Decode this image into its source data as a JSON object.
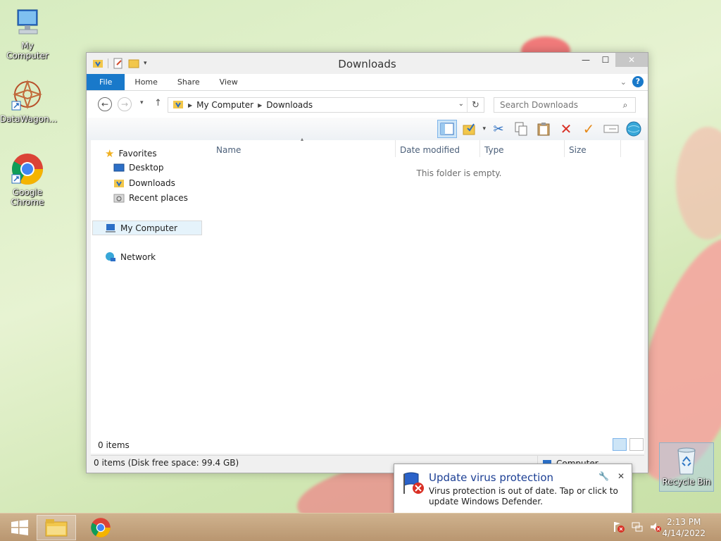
{
  "desktop": {
    "icons": [
      {
        "label": "My Computer"
      },
      {
        "label": "DataWagon..."
      },
      {
        "label": "Google Chrome"
      }
    ],
    "recycle_bin": "Recycle Bin"
  },
  "window": {
    "title": "Downloads",
    "tabs": [
      "File",
      "Home",
      "Share",
      "View"
    ],
    "address": {
      "crumbs": [
        "My Computer",
        "Downloads"
      ]
    },
    "search_placeholder": "Search Downloads",
    "nav": {
      "favorites": "Favorites",
      "desktop": "Desktop",
      "downloads": "Downloads",
      "recent": "Recent places",
      "computer": "My Computer",
      "network": "Network"
    },
    "columns": [
      "Name",
      "Date modified",
      "Type",
      "Size"
    ],
    "empty_text": "This folder is empty.",
    "items_count": "0 items",
    "status_text": "0 items (Disk free space: 99.4 GB)",
    "status_right": "Computer"
  },
  "notification": {
    "title": "Update virus protection",
    "body": "Virus protection is out of date. Tap or click to update Windows Defender."
  },
  "taskbar": {
    "time": "2:13 PM",
    "date": "4/14/2022"
  },
  "colors": {
    "accent": "#1979ca",
    "taskbar": "#c4a27c"
  }
}
